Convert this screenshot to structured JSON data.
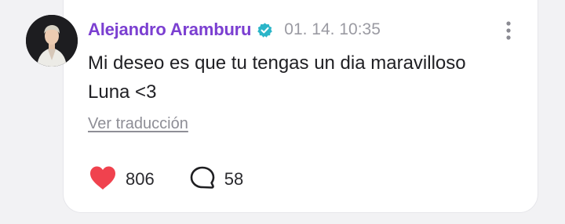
{
  "post": {
    "author": "Alejandro Aramburu",
    "timestamp": "01. 14. 10:35",
    "message": "Mi deseo es que tu tengas un dia maravilloso Luna <3",
    "translate_label": "Ver traducción"
  },
  "actions": {
    "likes": "806",
    "comments": "58"
  },
  "icons": {
    "verified": "verified-badge-icon",
    "more": "more-vertical-icon",
    "like": "heart-icon",
    "comment": "speech-bubble-icon"
  },
  "colors": {
    "author": "#7b3fd1",
    "verified_badge": "#2bb5c8",
    "heart": "#f0424e",
    "timestamp": "#9a9aa2"
  }
}
